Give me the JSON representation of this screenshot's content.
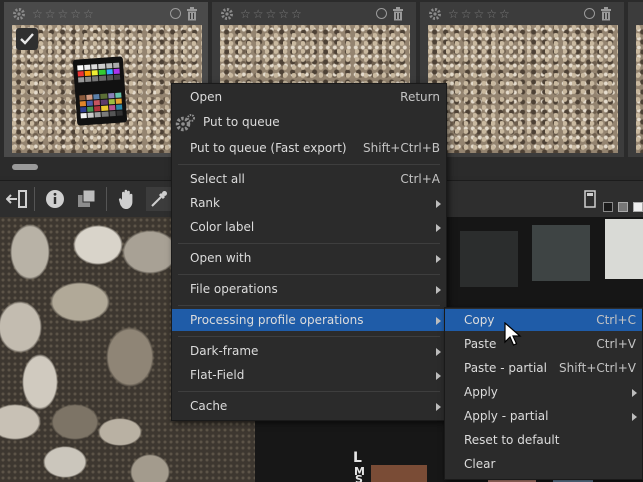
{
  "filmstrip": {
    "thumbnails": [
      {
        "rating": "☆☆☆☆☆",
        "selected": true
      },
      {
        "rating": "☆☆☆☆☆",
        "selected": false
      },
      {
        "rating": "☆☆☆☆☆",
        "selected": false
      }
    ]
  },
  "preview": {
    "chart_letters": [
      "L",
      "M",
      "S"
    ]
  },
  "context_menu": {
    "items": [
      {
        "label": "Open",
        "shortcut": "Return"
      },
      {
        "label": "Put to queue",
        "shortcut": ""
      },
      {
        "label": "Put to queue (Fast export)",
        "shortcut": "Shift+Ctrl+B"
      },
      {
        "label": "Select all",
        "shortcut": "Ctrl+A"
      },
      {
        "label": "Rank",
        "shortcut": ""
      },
      {
        "label": "Color label",
        "shortcut": ""
      },
      {
        "label": "Open with",
        "shortcut": ""
      },
      {
        "label": "File operations",
        "shortcut": ""
      },
      {
        "label": "Processing profile operations",
        "shortcut": ""
      },
      {
        "label": "Dark-frame",
        "shortcut": ""
      },
      {
        "label": "Flat-Field",
        "shortcut": ""
      },
      {
        "label": "Cache",
        "shortcut": ""
      }
    ]
  },
  "submenu": {
    "items": [
      {
        "label": "Copy",
        "shortcut": "Ctrl+C"
      },
      {
        "label": "Paste",
        "shortcut": "Ctrl+V"
      },
      {
        "label": "Paste - partial",
        "shortcut": "Shift+Ctrl+V"
      },
      {
        "label": "Apply",
        "shortcut": ""
      },
      {
        "label": "Apply - partial",
        "shortcut": ""
      },
      {
        "label": "Reset to default",
        "shortcut": ""
      },
      {
        "label": "Clear",
        "shortcut": ""
      }
    ]
  },
  "colors": {
    "highlight": "#1f5ca8",
    "menu_bg": "#2b2b2b",
    "app_bg": "#2a2a2a"
  }
}
